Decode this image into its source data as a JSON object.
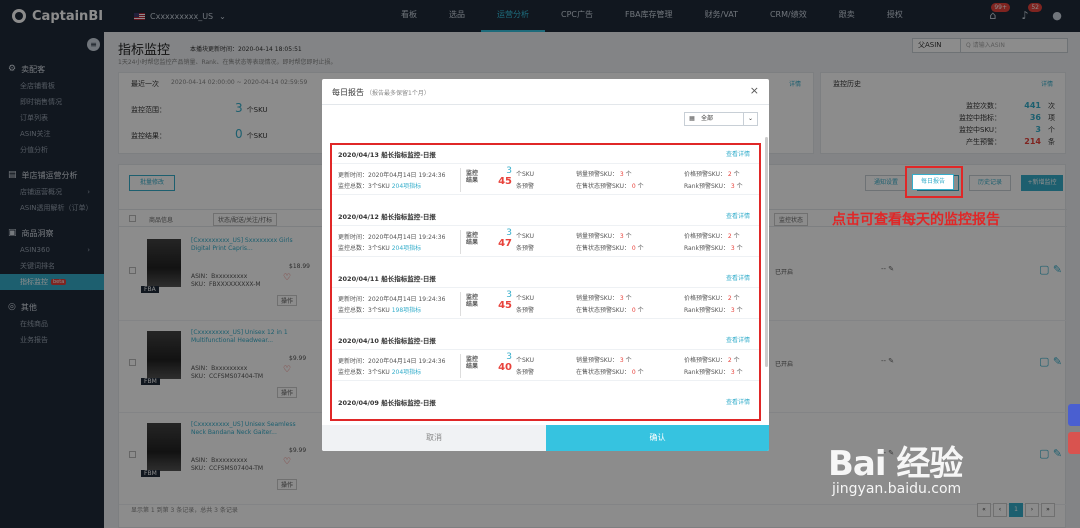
{
  "app": {
    "name": "CaptainBI",
    "store": "Cxxxxxxxxx_US"
  },
  "nav": [
    "看板",
    "选品",
    "运营分析",
    "CPC广告",
    "FBA库存管理",
    "财务/VAT",
    "CRM/绩效",
    "跟卖",
    "授权"
  ],
  "top_badges": {
    "notif1": "99+",
    "notif2": "52"
  },
  "sidebar": {
    "groups": [
      {
        "label": "卖配客",
        "items": [
          "全店铺看板",
          "即时销售情况",
          "订单列表",
          "ASIN关注",
          "分值分析"
        ]
      },
      {
        "label": "单店铺运营分析",
        "items": [
          "店铺运营概况",
          "ASIN透用解析（订单）"
        ]
      },
      {
        "label": "商品洞察",
        "items": [
          "ASIN360",
          "关键词排名",
          "指标监控"
        ]
      },
      {
        "label": "其他",
        "items": [
          "在线商品",
          "业务报告"
        ]
      }
    ],
    "beta": "beta"
  },
  "page": {
    "title": "指标监控",
    "update_time": "本播块更新时间：2020-04-14 18:05:51",
    "desc": "1天24小时帮您监控产品销量、Rank、在售状态等表现情况，即时帮您即时止损。",
    "search_select": "父ASIN",
    "search_placeholder": "Q 请输入ASIN",
    "recent": {
      "label": "最近一次",
      "range": "2020-04-14 02:00:00 ~ 2020-04-14 02:59:59",
      "link": "详情",
      "scope_label": "监控范围：",
      "scope_value": "3",
      "scope_unit": "个SKU",
      "result_label": "监控结果：",
      "result_value": "0",
      "result_unit": "个SKU"
    },
    "history": {
      "title": "监控历史",
      "link": "详情",
      "rows": [
        {
          "label": "监控次数：",
          "value": "441",
          "unit": "次"
        },
        {
          "label": "监控中指标：",
          "value": "36",
          "unit": "项"
        },
        {
          "label": "监控中SKU：",
          "value": "3",
          "unit": "个"
        },
        {
          "label": "产生预警：",
          "value": "214",
          "unit": "条"
        }
      ]
    },
    "buttons": {
      "bulk": "批量修改",
      "notify": "通知设置",
      "daily": "每日报告",
      "history": "历史记录",
      "add": "+新增监控"
    },
    "annotation": "点击可查看每天的监控报告",
    "table": {
      "col_product": "商品信息",
      "col_filter": "状态/配送/关注/打标",
      "col_status": "监控状态"
    },
    "products": [
      {
        "title": "[Cxxxxxxxxx_US] Sxxxxxxxx Girls Digital Print Capris...",
        "price": "$18.99",
        "asin": "ASIN：Bxxxxxxxxx",
        "sku": "SKU：FBXXXXXXXXX-M",
        "tag": "FBA",
        "ops": "操作",
        "status": "已开启",
        "dash": "-- "
      },
      {
        "title": "[Cxxxxxxxxx_US] Unisex 12 in 1 Multifunctional Headwear...",
        "price": "$9.99",
        "asin": "ASIN：Bxxxxxxxxx",
        "sku": "SKU：CCFSMS07404-TM",
        "tag": "FBM",
        "ops": "操作",
        "status": "已开启",
        "dash": "-- "
      },
      {
        "title": "[Cxxxxxxxxx_US] Unisex Seamless Neck Bandana Neck Gaiter...",
        "price": "$9.99",
        "asin": "ASIN：Bxxxxxxxxx",
        "sku": "SKU：CCFSMS07404-TM",
        "tag": "FBM",
        "ops": "操作",
        "status": "",
        "dash": "-- "
      }
    ],
    "pager_text": "显示第 1 到第 3 条记录，总共 3 条记录",
    "pager": [
      "«",
      "‹",
      "1",
      "›",
      "»"
    ]
  },
  "modal": {
    "title": "每日报告",
    "subtitle": "（报告最多保留1个月）",
    "filter": "全部",
    "cancel": "取消",
    "ok": "确认",
    "link": "查看详情",
    "reports": [
      {
        "title": "2020/04/13 船长指标监控-日报",
        "update": "更新时间：2020年04月14日 19:24:36",
        "total_prefix": "监控总数：3个SKU",
        "total_hl": "204项指标",
        "n1": "3",
        "u1": "个SKU",
        "n2": "45",
        "u2": "条预警",
        "sales": "3",
        "stock": "0",
        "price": "2",
        "rank": "3"
      },
      {
        "title": "2020/04/12 船长指标监控-日报",
        "update": "更新时间：2020年04月14日 19:24:36",
        "total_prefix": "监控总数：3个SKU",
        "total_hl": "204项指标",
        "n1": "3",
        "u1": "个SKU",
        "n2": "47",
        "u2": "条预警",
        "sales": "3",
        "stock": "0",
        "price": "2",
        "rank": "3"
      },
      {
        "title": "2020/04/11 船长指标监控-日报",
        "update": "更新时间：2020年04月14日 19:24:36",
        "total_prefix": "监控总数：3个SKU",
        "total_hl": "198项指标",
        "n1": "3",
        "u1": "个SKU",
        "n2": "45",
        "u2": "条预警",
        "sales": "3",
        "stock": "0",
        "price": "2",
        "rank": "3"
      },
      {
        "title": "2020/04/10 船长指标监控-日报",
        "update": "更新时间：2020年04月14日 19:24:36",
        "total_prefix": "监控总数：3个SKU",
        "total_hl": "204项指标",
        "n1": "3",
        "u1": "个SKU",
        "n2": "40",
        "u2": "条预警",
        "sales": "3",
        "stock": "0",
        "price": "2",
        "rank": "3"
      },
      {
        "title": "2020/04/09 船长指标监控-日报"
      }
    ],
    "warn_labels": {
      "sales": "销量预警SKU：",
      "stock": "在售状态预警SKU：",
      "price": "价格预警SKU：",
      "rank": "Rank预警SKU：",
      "unit": "个"
    },
    "icon_text": "监控结果"
  },
  "watermark": {
    "brand": "Bai 经验",
    "url": "jingyan.baidu.com"
  }
}
